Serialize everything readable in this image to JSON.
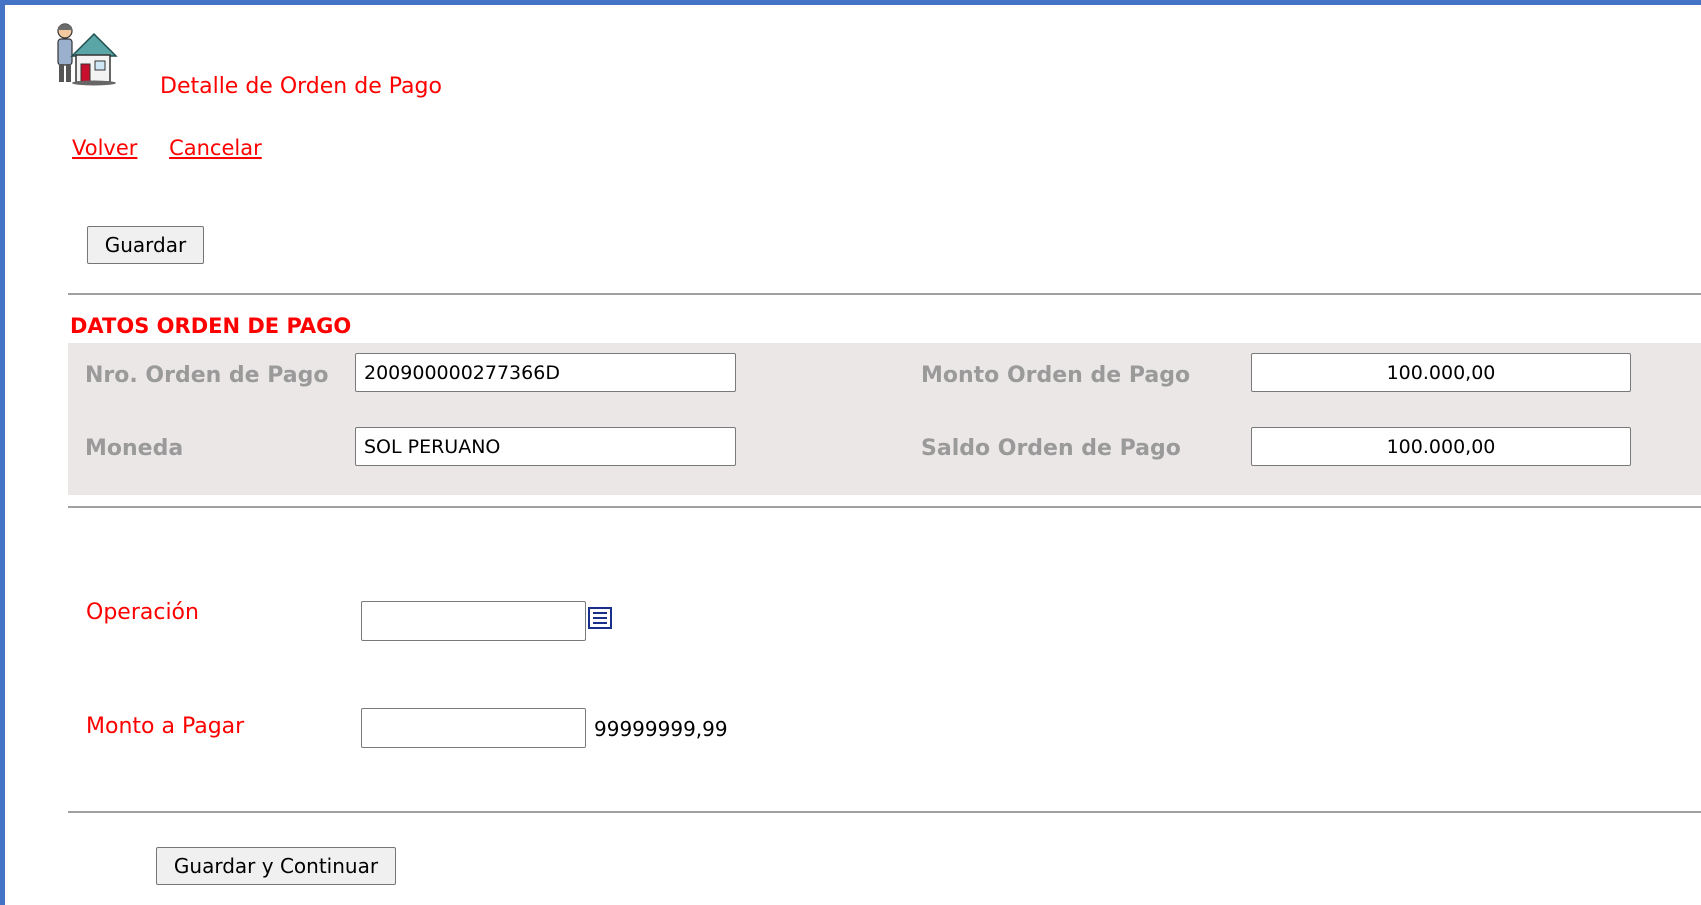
{
  "header": {
    "title": "Detalle de Orden de Pago",
    "icon": "user-house-icon"
  },
  "nav": {
    "back_label": "Volver",
    "cancel_label": "Cancelar"
  },
  "toolbar": {
    "save_label": "Guardar"
  },
  "order": {
    "section_title": "DATOS ORDEN DE PAGO",
    "nro_label": "Nro. Orden de Pago",
    "nro_value": "200900000277366D",
    "moneda_label": "Moneda",
    "moneda_value": "SOL PERUANO",
    "monto_label": "Monto Orden de Pago",
    "monto_value": "100.000,00",
    "saldo_label": "Saldo Orden de Pago",
    "saldo_value": "100.000,00"
  },
  "form": {
    "operacion_label": "Operación",
    "operacion_value": "",
    "operacion_lookup_icon": "list-lookup-icon",
    "monto_pagar_label": "Monto a Pagar",
    "monto_pagar_value": "",
    "monto_pagar_hint": "99999999,99"
  },
  "footer": {
    "save_continue_label": "Guardar y Continuar"
  },
  "colors": {
    "accent": "#ff0000",
    "frame": "#4472c4",
    "panel": "#ebe7e7",
    "muted_label": "#9a9a9a"
  }
}
